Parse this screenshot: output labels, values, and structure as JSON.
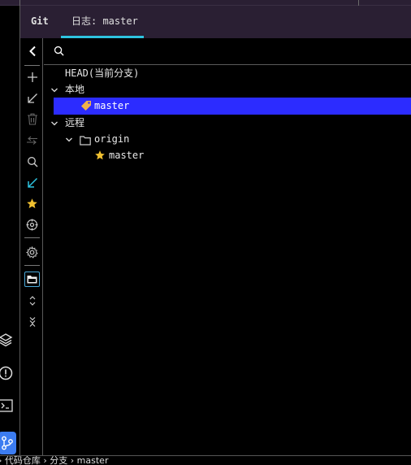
{
  "tabs": {
    "git": "Git",
    "log": "日志: master"
  },
  "search": {
    "placeholder": "",
    "value": ""
  },
  "tree": {
    "head": "HEAD(当前分支)",
    "local_group": "本地",
    "local_branch": "master",
    "remote_group": "远程",
    "remote_name": "origin",
    "remote_branch": "master"
  },
  "toolbar_icons": [
    "collapse-left-icon",
    "add-icon",
    "pull-icon",
    "delete-icon",
    "compare-icon",
    "search-icon",
    "checkout-icon",
    "star-icon",
    "crosshair-icon",
    "settings-icon",
    "group-by-directory-icon",
    "expand-icon",
    "collapse-icon"
  ],
  "activity_icons": [
    "layers-icon",
    "problems-icon",
    "terminal-icon",
    "git-icon"
  ],
  "statusbar": {
    "text": "› 代码仓库 › 分支 › master"
  },
  "colors": {
    "selection": "#2c2cff",
    "tab_underline": "#2ec4e0",
    "tag": "#f0b34a",
    "star": "#f0c030",
    "accent_tool": "#2ec4e0",
    "active_activity": "#3c7cf0"
  }
}
